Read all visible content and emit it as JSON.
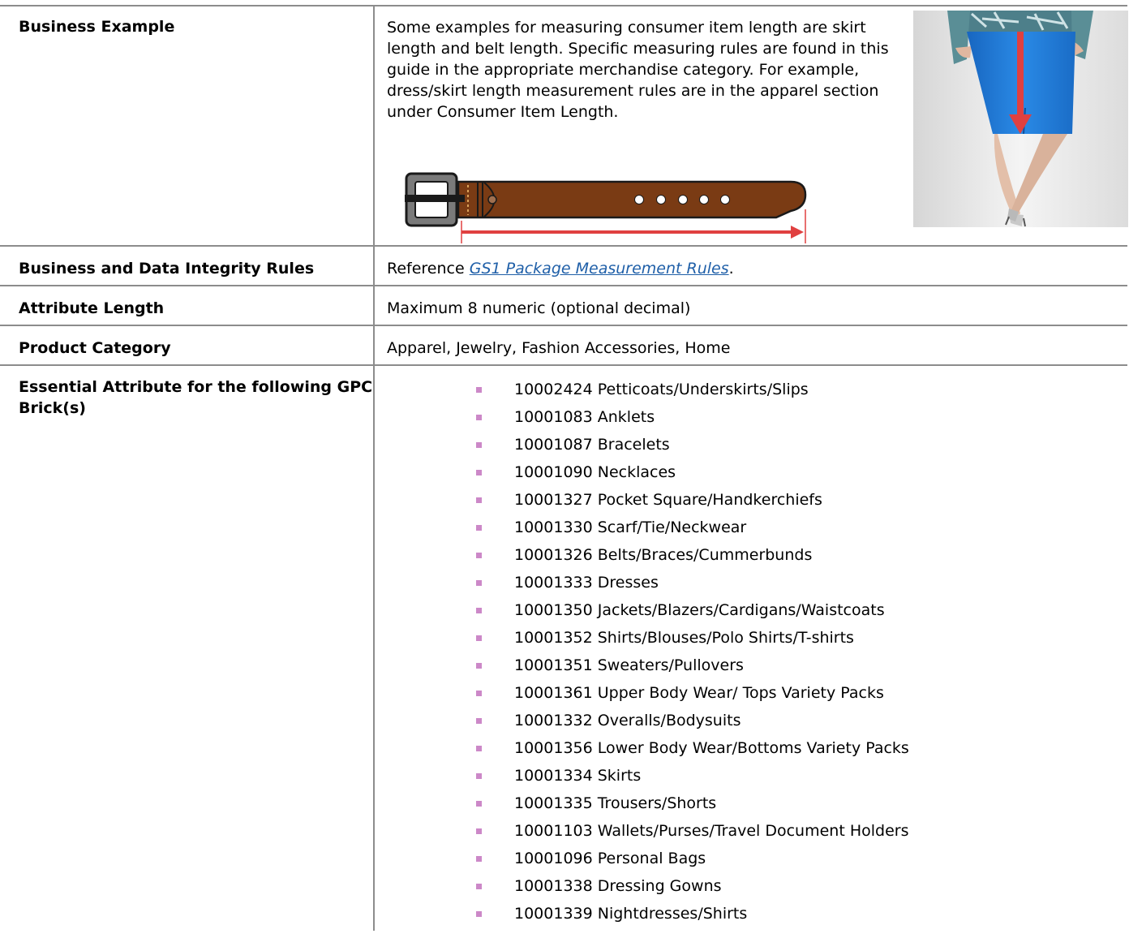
{
  "rows": {
    "business_example": {
      "label": "Business Example",
      "text": "Some examples for measuring consumer item length are skirt length and belt length. Specific measuring rules are found in this guide in the appropriate merchandise category. For example, dress/skirt length measurement rules are in the apparel section under Consumer Item Length."
    },
    "integrity_rules": {
      "label": "Business and Data Integrity Rules",
      "prefix": "Reference ",
      "link_text": "GS1 Package Measurement Rules",
      "suffix": "."
    },
    "attribute_length": {
      "label": "Attribute Length",
      "value": "Maximum 8 numeric (optional decimal)"
    },
    "product_category": {
      "label": "Product Category",
      "value": "Apparel, Jewelry, Fashion Accessories, Home"
    },
    "gpc_bricks": {
      "label": "Essential Attribute for the following GPC Brick(s)",
      "items": [
        "10002424 Petticoats/Underskirts/Slips",
        "10001083 Anklets",
        "10001087 Bracelets",
        "10001090 Necklaces",
        "10001327 Pocket Square/Handkerchiefs",
        "10001330 Scarf/Tie/Neckwear",
        "10001326 Belts/Braces/Cummerbunds",
        "10001333 Dresses",
        "10001350 Jackets/Blazers/Cardigans/Waistcoats",
        "10001352 Shirts/Blouses/Polo Shirts/T-shirts",
        "10001351 Sweaters/Pullovers",
        "10001361 Upper Body Wear/ Tops Variety Packs",
        "10001332 Overalls/Bodysuits",
        "10001356 Lower Body Wear/Bottoms Variety Packs",
        "10001334 Skirts",
        "10001335 Trousers/Shorts",
        "10001103 Wallets/Purses/Travel Document Holders",
        "10001096 Personal Bags",
        "10001338 Dressing Gowns",
        "10001339 Nightdresses/Shirts"
      ]
    }
  },
  "colors": {
    "border": "#8c8c8c",
    "link": "#1f5fa8",
    "bullet": "#cc88c8",
    "belt_brown": "#7a3b14",
    "measure_red": "#e04040",
    "skirt_blue": "#1f7fd6"
  },
  "figures": {
    "belt": "belt-illustration",
    "skirt": "skirt-photo"
  }
}
